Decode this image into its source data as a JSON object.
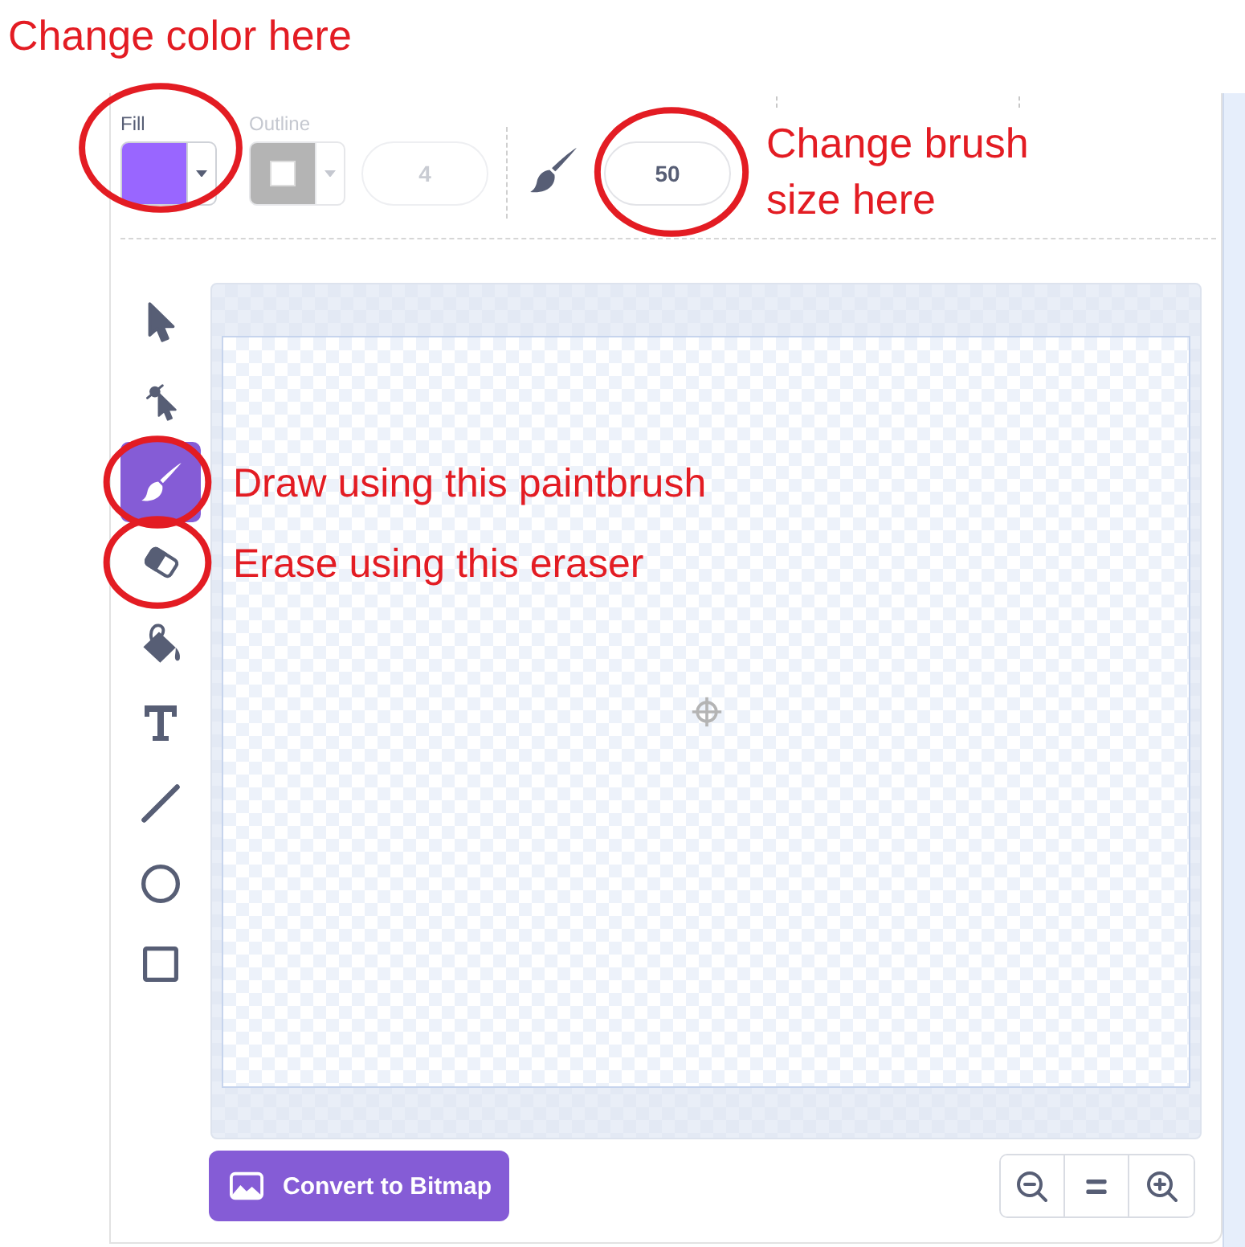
{
  "top_callout": "Change color here",
  "toolbar": {
    "fill": {
      "label": "Fill",
      "color": "#9966ff",
      "circled": true
    },
    "outline": {
      "label": "Outline",
      "disabled": true,
      "circled": false
    },
    "outline_width": {
      "value": "4",
      "disabled": true
    },
    "brush_size": {
      "value": "50",
      "circled": true,
      "callout": "Change brush size here"
    }
  },
  "tools": [
    {
      "kind": "select",
      "selected": false,
      "circled": false
    },
    {
      "kind": "reshape",
      "selected": false,
      "circled": false
    },
    {
      "kind": "brush",
      "selected": true,
      "circled": true,
      "callout": "Draw using this paintbrush"
    },
    {
      "kind": "eraser",
      "selected": false,
      "circled": true,
      "callout": "Erase using this eraser"
    },
    {
      "kind": "fill",
      "selected": false,
      "circled": false
    },
    {
      "kind": "text",
      "selected": false,
      "circled": false
    },
    {
      "kind": "line",
      "selected": false,
      "circled": false
    },
    {
      "kind": "circle",
      "selected": false,
      "circled": false
    },
    {
      "kind": "rect",
      "selected": false,
      "circled": false
    }
  ],
  "convert_button": "Convert to Bitmap"
}
